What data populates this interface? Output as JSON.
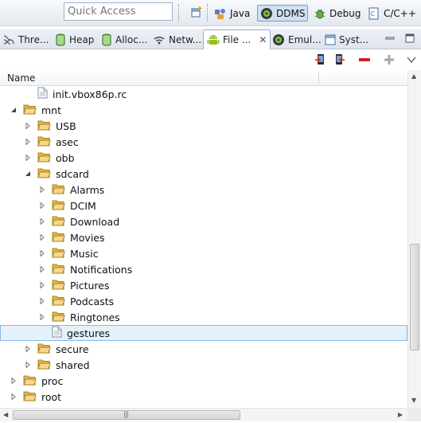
{
  "toolbar": {
    "quick_access_placeholder": "Quick Access",
    "perspectives": [
      {
        "label": "Java",
        "icon": "java-perspective-icon",
        "active": false
      },
      {
        "label": "DDMS",
        "icon": "ddms-perspective-icon",
        "active": true
      },
      {
        "label": "Debug",
        "icon": "debug-perspective-icon",
        "active": false
      },
      {
        "label": "C/C++",
        "icon": "cpp-perspective-icon",
        "active": false
      }
    ]
  },
  "tabs": [
    {
      "label": "Thre...",
      "icon": "threads-icon",
      "active": false
    },
    {
      "label": "Heap",
      "icon": "heap-icon",
      "active": false
    },
    {
      "label": "Alloc...",
      "icon": "allocation-icon",
      "active": false
    },
    {
      "label": "Netw...",
      "icon": "network-icon",
      "active": false
    },
    {
      "label": "File ...",
      "icon": "android-icon",
      "active": true,
      "closable": true
    },
    {
      "label": "Emul...",
      "icon": "emulator-icon",
      "active": false
    },
    {
      "label": "Syst...",
      "icon": "system-icon",
      "active": false
    }
  ],
  "file_explorer": {
    "column_name": "Name",
    "accent_folder": "#e7b74b",
    "selection_color": "#e5f1fb",
    "rows": [
      {
        "label": "init.vbox86p.rc",
        "depth": 1,
        "type": "file",
        "expander": "none"
      },
      {
        "label": "mnt",
        "depth": 0,
        "type": "folder",
        "expander": "expanded"
      },
      {
        "label": "USB",
        "depth": 1,
        "type": "folder",
        "expander": "collapsed"
      },
      {
        "label": "asec",
        "depth": 1,
        "type": "folder",
        "expander": "collapsed"
      },
      {
        "label": "obb",
        "depth": 1,
        "type": "folder",
        "expander": "collapsed"
      },
      {
        "label": "sdcard",
        "depth": 1,
        "type": "folder",
        "expander": "expanded"
      },
      {
        "label": "Alarms",
        "depth": 2,
        "type": "folder",
        "expander": "collapsed"
      },
      {
        "label": "DCIM",
        "depth": 2,
        "type": "folder",
        "expander": "collapsed"
      },
      {
        "label": "Download",
        "depth": 2,
        "type": "folder",
        "expander": "collapsed"
      },
      {
        "label": "Movies",
        "depth": 2,
        "type": "folder",
        "expander": "collapsed"
      },
      {
        "label": "Music",
        "depth": 2,
        "type": "folder",
        "expander": "collapsed"
      },
      {
        "label": "Notifications",
        "depth": 2,
        "type": "folder",
        "expander": "collapsed"
      },
      {
        "label": "Pictures",
        "depth": 2,
        "type": "folder",
        "expander": "collapsed"
      },
      {
        "label": "Podcasts",
        "depth": 2,
        "type": "folder",
        "expander": "collapsed"
      },
      {
        "label": "Ringtones",
        "depth": 2,
        "type": "folder",
        "expander": "collapsed"
      },
      {
        "label": "gestures",
        "depth": 2,
        "type": "file",
        "expander": "none",
        "selected": true
      },
      {
        "label": "secure",
        "depth": 1,
        "type": "folder",
        "expander": "collapsed"
      },
      {
        "label": "shared",
        "depth": 1,
        "type": "folder",
        "expander": "collapsed"
      },
      {
        "label": "proc",
        "depth": 0,
        "type": "folder",
        "expander": "collapsed"
      },
      {
        "label": "root",
        "depth": 0,
        "type": "folder",
        "expander": "collapsed"
      }
    ]
  }
}
